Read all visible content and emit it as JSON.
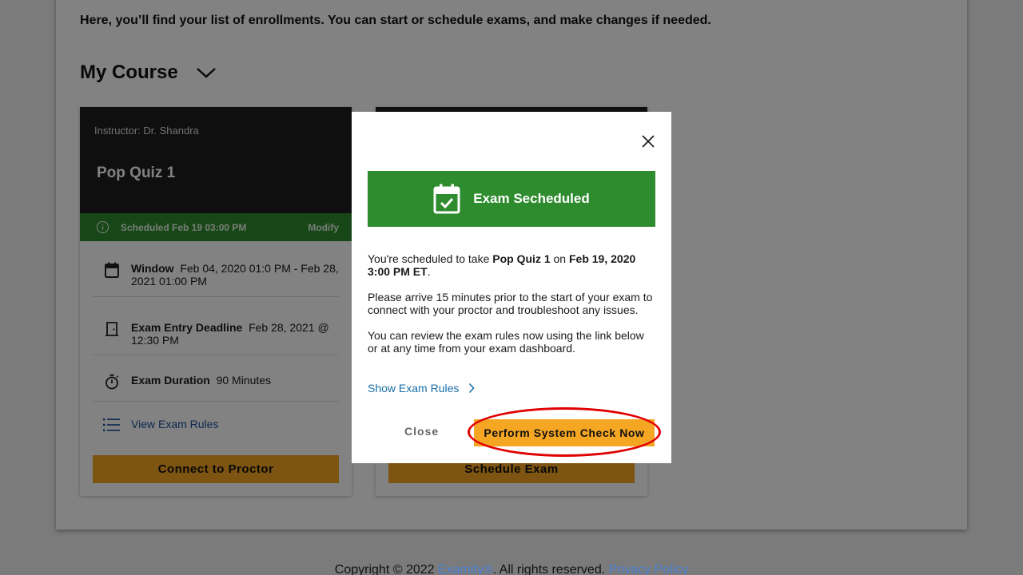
{
  "page": {
    "intro": "Here, you’ll find your list of enrollments. You can start or schedule exams, and make changes if needed.",
    "course_title": "My Course"
  },
  "card1": {
    "instructor": "Instructor: Dr. Shandra",
    "quiz_name": "Pop Quiz 1",
    "scheduled": "Scheduled Feb 19 03:00 PM",
    "modify": "Modify",
    "window_label": "Window",
    "window_value": "Feb 04, 2020 01:0 PM - Feb 28, 2021 01:00 PM",
    "deadline_label": "Exam Entry Deadline",
    "deadline_value": "Feb 28, 2021 @ 12:30 PM",
    "duration_label": "Exam Duration",
    "duration_value": "90 Minutes",
    "rules_link": "View Exam Rules",
    "proctor_button": "Connect to Proctor"
  },
  "card2": {
    "schedule_button": "Schedule Exam"
  },
  "modal": {
    "banner": "Exam Secheduled",
    "line1_pre": "You're scheduled to take ",
    "line1_quiz": "Pop Quiz 1",
    "line1_mid": " on ",
    "line1_date": "Feb 19, 2020 3:00 PM ET",
    "line1_end": ".",
    "line2": "Please arrive 15 minutes prior to the start of your exam to connect with your proctor and troubleshoot any issues.",
    "line3": "You can review the exam rules now using the link below or at any time from your exam dashboard.",
    "rules_link": "Show Exam Rules",
    "close_button": "Close",
    "check_button": "Perform System Check Now"
  },
  "footer": {
    "copyright": "Copyright © 2022 ",
    "brand": "Examity®",
    "rights": ".  All rights reserved. ",
    "privacy": "Privacy Policy"
  },
  "colors": {
    "success_green": "#2e8b2e",
    "action_yellow": "#f5a623",
    "link_blue": "#1a6fa8",
    "highlight_red": "#e00000"
  }
}
